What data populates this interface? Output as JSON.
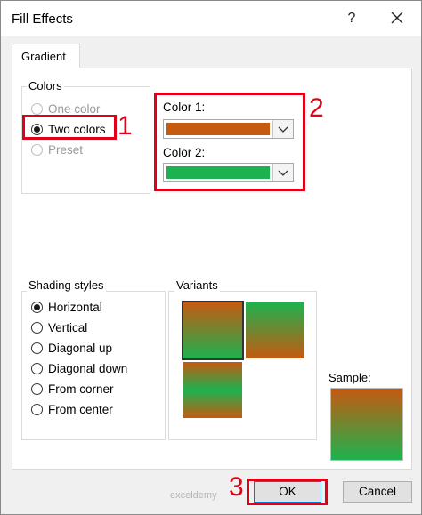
{
  "dialog": {
    "title": "Fill Effects",
    "help_label": "?"
  },
  "tab": {
    "label": "Gradient"
  },
  "colors": {
    "group_label": "Colors",
    "options": [
      {
        "label": "One color",
        "checked": false,
        "disabled": true
      },
      {
        "label": "Two colors",
        "checked": true,
        "disabled": false
      },
      {
        "label": "Preset",
        "checked": false,
        "disabled": true
      }
    ],
    "color1_label": "Color 1:",
    "color1_value": "#c55a11",
    "color2_label": "Color 2:",
    "color2_value": "#1db24f"
  },
  "shading": {
    "group_label": "Shading styles",
    "options": [
      {
        "label": "Horizontal",
        "checked": true
      },
      {
        "label": "Vertical",
        "checked": false
      },
      {
        "label": "Diagonal up",
        "checked": false
      },
      {
        "label": "Diagonal down",
        "checked": false
      },
      {
        "label": "From corner",
        "checked": false
      },
      {
        "label": "From center",
        "checked": false
      }
    ]
  },
  "variants": {
    "group_label": "Variants"
  },
  "sample": {
    "label": "Sample:"
  },
  "buttons": {
    "ok_label": "OK",
    "cancel_label": "Cancel"
  },
  "annotations": {
    "n1": "1",
    "n2": "2",
    "n3": "3"
  },
  "watermark": {
    "text": "exceldemy"
  }
}
